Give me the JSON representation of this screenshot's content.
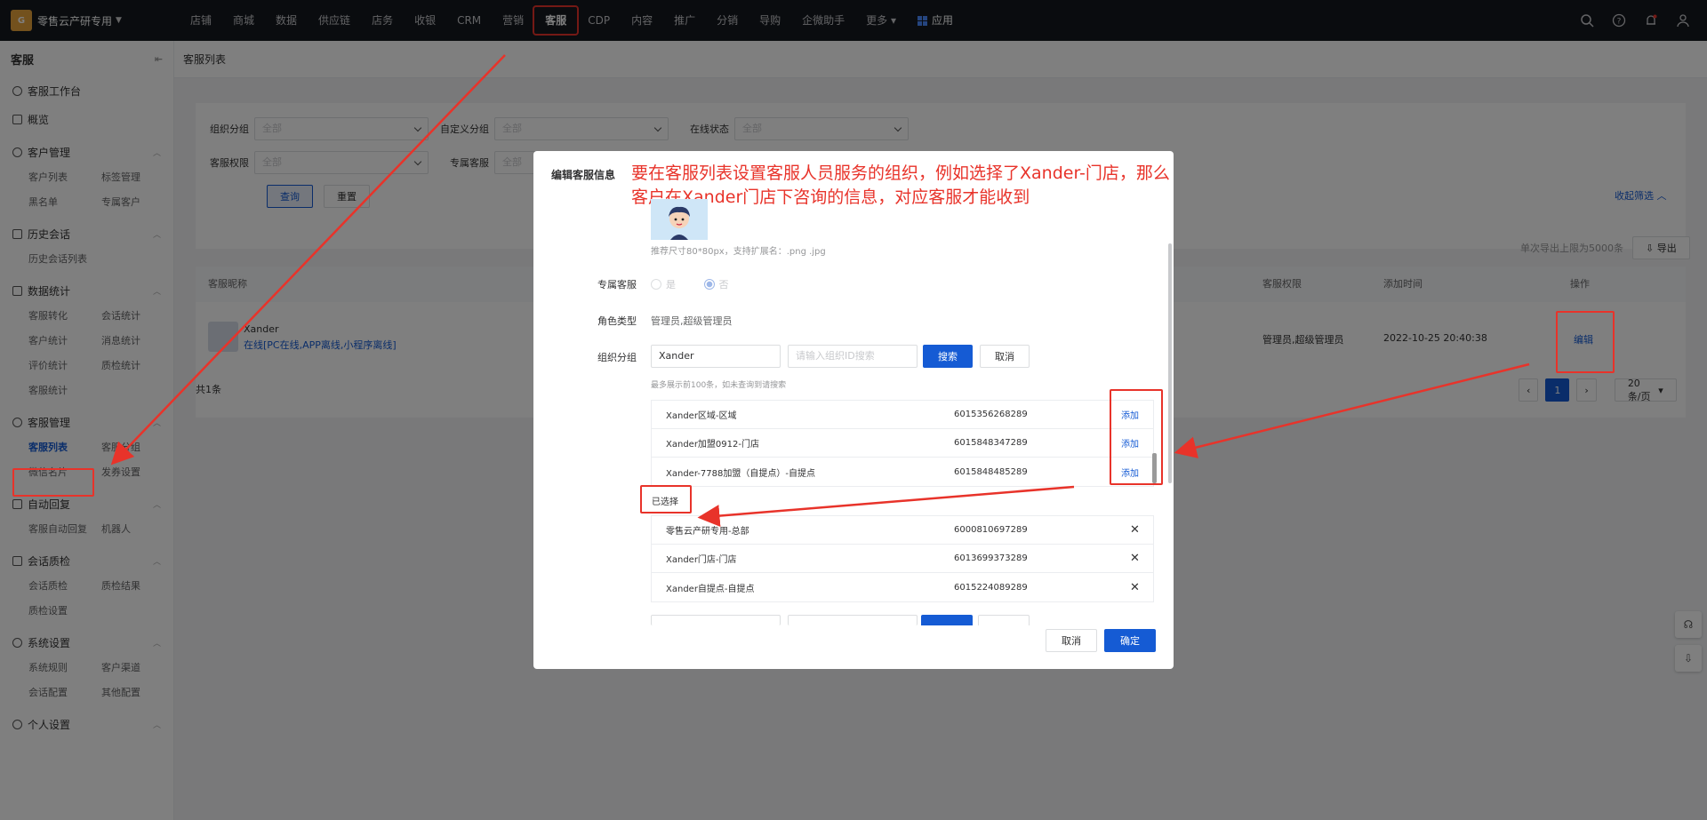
{
  "topbar": {
    "brand": "零售云产研专用",
    "nav": [
      "店铺",
      "商城",
      "数据",
      "供应链",
      "店务",
      "收银",
      "CRM",
      "营销",
      "客服",
      "CDP",
      "内容",
      "推广",
      "分销",
      "导购",
      "企微助手",
      "更多"
    ],
    "apps": "应用"
  },
  "sidebar": {
    "title": "客服",
    "workbench": "客服工作台",
    "overview": "概览",
    "groups": [
      {
        "title": "客户管理",
        "items": [
          "客户列表",
          "标签管理",
          "黑名单",
          "专属客户"
        ]
      },
      {
        "title": "历史会话",
        "items": [
          "历史会话列表"
        ]
      },
      {
        "title": "数据统计",
        "items": [
          "客服转化",
          "会话统计",
          "客户统计",
          "消息统计",
          "评价统计",
          "质检统计",
          "客服统计"
        ]
      },
      {
        "title": "客服管理",
        "items": [
          "客服列表",
          "客服分组",
          "微信名片",
          "发券设置"
        ]
      },
      {
        "title": "自动回复",
        "items": [
          "客服自动回复",
          "机器人"
        ]
      },
      {
        "title": "会话质检",
        "items": [
          "会话质检",
          "质检结果",
          "质检设置"
        ]
      },
      {
        "title": "系统设置",
        "items": [
          "系统规则",
          "客户渠道",
          "会话配置",
          "其他配置"
        ]
      },
      {
        "title": "个人设置",
        "items": []
      }
    ]
  },
  "main": {
    "breadcrumb": "客服列表",
    "filters": {
      "org_group": "组织分组",
      "custom_group": "自定义分组",
      "online_status": "在线状态",
      "permission": "客服权限",
      "exclusive": "专属客服",
      "all": "全部",
      "query": "查询",
      "reset": "重置",
      "collapse": "收起筛选"
    },
    "export_limit": "单次导出上限为5000条",
    "export": "导出",
    "table": {
      "col_name": "客服昵称",
      "col_permission": "客服权限",
      "col_time": "添加时间",
      "col_action": "操作",
      "row": {
        "name": "Xander",
        "status": "在线[PC在线,APP离线,小程序离线]",
        "permission": "管理员,超级管理员",
        "time": "2022-10-25 20:40:38",
        "action": "编辑"
      }
    },
    "total": "共1条",
    "page": "1",
    "page_size": "20 条/页"
  },
  "modal": {
    "title": "编辑客服信息",
    "annotation": "要在客服列表设置客服人员服务的组织，例如选择了Xander-门店，那么客户在Xander门店下咨询的信息，对应客服才能收到",
    "avatar_hint": "推荐尺寸80*80px，支持扩展名：.png .jpg",
    "exclusive_label": "专属客服",
    "yes": "是",
    "no": "否",
    "role_label": "角色类型",
    "role_value": "管理员,超级管理员",
    "org_label": "组织分组",
    "org_search_value": "Xander",
    "org_id_placeholder": "请输入组织ID搜索",
    "search": "搜索",
    "cancel_search": "取消",
    "hint": "最多展示前100条，如未查询到请搜索",
    "candidates": [
      {
        "name": "Xander区域-区域",
        "id": "6015356268289",
        "action": "添加"
      },
      {
        "name": "Xander加盟0912-门店",
        "id": "6015848347289",
        "action": "添加"
      },
      {
        "name": "Xander-7788加盟（自提点）-自提点",
        "id": "6015848485289",
        "action": "添加"
      }
    ],
    "selected_label": "已选择",
    "selected": [
      {
        "name": "零售云产研专用-总部",
        "id": "6000810697289"
      },
      {
        "name": "Xander门店-门店",
        "id": "6013699373289"
      },
      {
        "name": "Xander自提点-自提点",
        "id": "6015224089289"
      }
    ],
    "cancel": "取消",
    "confirm": "确定"
  },
  "colors": {
    "primary": "#155bd4",
    "annotation": "#e8332a",
    "topbar": "#14181f"
  }
}
